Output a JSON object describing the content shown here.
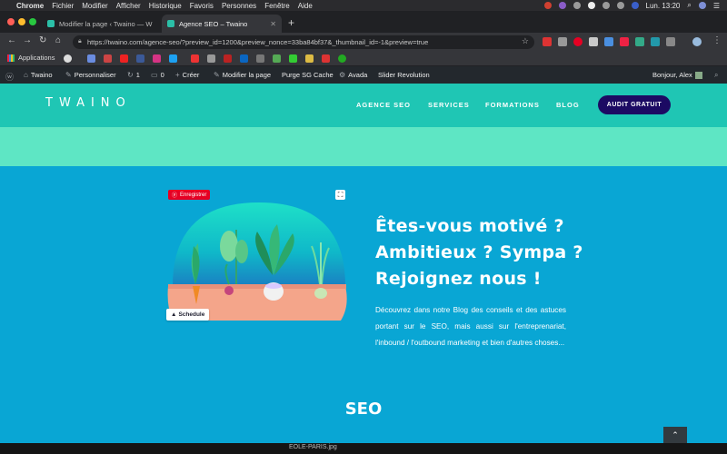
{
  "menubar": {
    "apple_icon": "apple-icon",
    "items": [
      "Chrome",
      "Fichier",
      "Modifier",
      "Afficher",
      "Historique",
      "Favoris",
      "Personnes",
      "Fenêtre",
      "Aide"
    ],
    "clock": "Lun. 13:20"
  },
  "tabs": [
    {
      "title": "Modifier la page ‹ Twaino — W",
      "active": false
    },
    {
      "title": "Agence SEO – Twaino",
      "active": true
    }
  ],
  "address_bar": {
    "url": "https://twaino.com/agence-seo/?preview_id=1200&preview_nonce=33ba84bf37&_thumbnail_id=-1&preview=true"
  },
  "bookmarks": {
    "apps_label": "Applications"
  },
  "wp_admin_bar": {
    "items": [
      {
        "label": "Twaino",
        "icon": "home-icon"
      },
      {
        "label": "Personnaliser",
        "icon": "brush-icon"
      },
      {
        "label": "1",
        "icon": "update-icon"
      },
      {
        "label": "0",
        "icon": "comment-icon"
      },
      {
        "label": "Créer",
        "icon": "plus-icon"
      },
      {
        "label": "Modifier la page",
        "icon": "pencil-icon"
      },
      {
        "label": "Purge SG Cache",
        "icon": ""
      },
      {
        "label": "Avada",
        "icon": "gear-icon"
      },
      {
        "label": "Slider Revolution",
        "icon": ""
      }
    ],
    "greeting": "Bonjour, Alex"
  },
  "site": {
    "logo": "TWAINO",
    "nav": [
      "AGENCE SEO",
      "SERVICES",
      "FORMATIONS",
      "BLOG"
    ],
    "cta": "AUDIT GRATUIT"
  },
  "hero": {
    "pin_label": "Enregistrer",
    "schedule_label": "Schedule",
    "headline": "Êtes-vous motivé ? Ambitieux ? Sympa ? Rejoignez nous !",
    "description": "Découvrez dans notre Blog des conseils et des astuces portant sur le SEO, mais aussi sur l'entreprenariat, l'inbound / l'outbound marketing et bien d'autres choses...",
    "section_title": "SEO",
    "back_to_top": "⌃"
  },
  "footer_strip": {
    "filename": "EOLE-PARIS.jpg"
  },
  "colors": {
    "header_teal": "#1fc6b4",
    "mint_band": "#5ee6c4",
    "hero_blue": "#09a6d4",
    "cta_navy": "#1c0a63",
    "pinterest_red": "#e60023"
  }
}
